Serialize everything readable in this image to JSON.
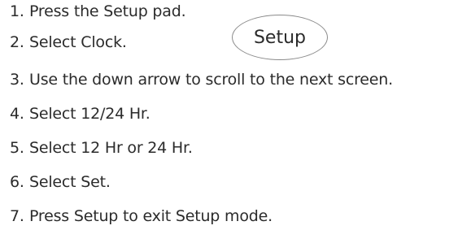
{
  "steps": [
    {
      "num": "1.",
      "text": "Press the Setup pad."
    },
    {
      "num": "2.",
      "text": "Select Clock."
    },
    {
      "num": "3.",
      "text": "Use the down arrow to scroll to the next screen."
    },
    {
      "num": "4.",
      "text": "Select 12/24 Hr."
    },
    {
      "num": "5.",
      "text": "Select 12 Hr or 24 Hr."
    },
    {
      "num": "6.",
      "text": "Select Set."
    },
    {
      "num": "7.",
      "text": "Press Setup to exit Setup mode."
    }
  ],
  "setup_pad": {
    "label": "Setup"
  }
}
